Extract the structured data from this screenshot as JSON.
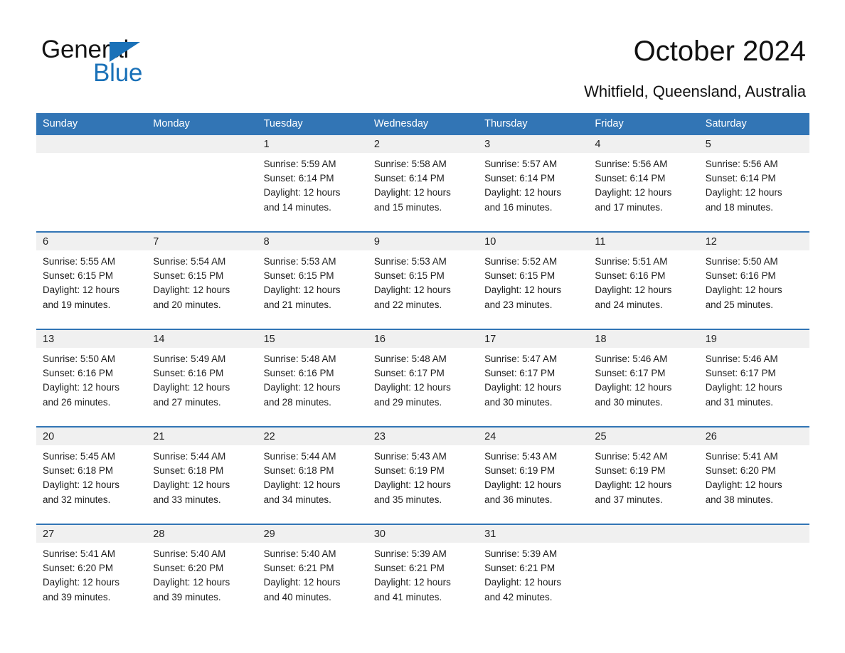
{
  "brand": {
    "name_top": "General",
    "name_bottom": "Blue",
    "accent_color": "#1a71b8",
    "triangle_icon": "triangle-icon"
  },
  "header": {
    "title": "October 2024",
    "location": "Whitfield, Queensland, Australia"
  },
  "theme": {
    "header_blue": "#3275b5",
    "date_band_gray": "#f0f0f0",
    "text_color": "#1d1d1d"
  },
  "calendar": {
    "weekday_headers": [
      "Sunday",
      "Monday",
      "Tuesday",
      "Wednesday",
      "Thursday",
      "Friday",
      "Saturday"
    ],
    "labels": {
      "sunrise": "Sunrise:",
      "sunset": "Sunset:",
      "daylight": "Daylight:"
    },
    "weeks": [
      [
        {
          "day": "",
          "sunrise": "",
          "sunset": "",
          "daylight_line1": "",
          "daylight_line2": "",
          "empty": true
        },
        {
          "day": "",
          "sunrise": "",
          "sunset": "",
          "daylight_line1": "",
          "daylight_line2": "",
          "empty": true
        },
        {
          "day": "1",
          "sunrise": "Sunrise: 5:59 AM",
          "sunset": "Sunset: 6:14 PM",
          "daylight_line1": "Daylight: 12 hours",
          "daylight_line2": "and 14 minutes."
        },
        {
          "day": "2",
          "sunrise": "Sunrise: 5:58 AM",
          "sunset": "Sunset: 6:14 PM",
          "daylight_line1": "Daylight: 12 hours",
          "daylight_line2": "and 15 minutes."
        },
        {
          "day": "3",
          "sunrise": "Sunrise: 5:57 AM",
          "sunset": "Sunset: 6:14 PM",
          "daylight_line1": "Daylight: 12 hours",
          "daylight_line2": "and 16 minutes."
        },
        {
          "day": "4",
          "sunrise": "Sunrise: 5:56 AM",
          "sunset": "Sunset: 6:14 PM",
          "daylight_line1": "Daylight: 12 hours",
          "daylight_line2": "and 17 minutes."
        },
        {
          "day": "5",
          "sunrise": "Sunrise: 5:56 AM",
          "sunset": "Sunset: 6:14 PM",
          "daylight_line1": "Daylight: 12 hours",
          "daylight_line2": "and 18 minutes."
        }
      ],
      [
        {
          "day": "6",
          "sunrise": "Sunrise: 5:55 AM",
          "sunset": "Sunset: 6:15 PM",
          "daylight_line1": "Daylight: 12 hours",
          "daylight_line2": "and 19 minutes."
        },
        {
          "day": "7",
          "sunrise": "Sunrise: 5:54 AM",
          "sunset": "Sunset: 6:15 PM",
          "daylight_line1": "Daylight: 12 hours",
          "daylight_line2": "and 20 minutes."
        },
        {
          "day": "8",
          "sunrise": "Sunrise: 5:53 AM",
          "sunset": "Sunset: 6:15 PM",
          "daylight_line1": "Daylight: 12 hours",
          "daylight_line2": "and 21 minutes."
        },
        {
          "day": "9",
          "sunrise": "Sunrise: 5:53 AM",
          "sunset": "Sunset: 6:15 PM",
          "daylight_line1": "Daylight: 12 hours",
          "daylight_line2": "and 22 minutes."
        },
        {
          "day": "10",
          "sunrise": "Sunrise: 5:52 AM",
          "sunset": "Sunset: 6:15 PM",
          "daylight_line1": "Daylight: 12 hours",
          "daylight_line2": "and 23 minutes."
        },
        {
          "day": "11",
          "sunrise": "Sunrise: 5:51 AM",
          "sunset": "Sunset: 6:16 PM",
          "daylight_line1": "Daylight: 12 hours",
          "daylight_line2": "and 24 minutes."
        },
        {
          "day": "12",
          "sunrise": "Sunrise: 5:50 AM",
          "sunset": "Sunset: 6:16 PM",
          "daylight_line1": "Daylight: 12 hours",
          "daylight_line2": "and 25 minutes."
        }
      ],
      [
        {
          "day": "13",
          "sunrise": "Sunrise: 5:50 AM",
          "sunset": "Sunset: 6:16 PM",
          "daylight_line1": "Daylight: 12 hours",
          "daylight_line2": "and 26 minutes."
        },
        {
          "day": "14",
          "sunrise": "Sunrise: 5:49 AM",
          "sunset": "Sunset: 6:16 PM",
          "daylight_line1": "Daylight: 12 hours",
          "daylight_line2": "and 27 minutes."
        },
        {
          "day": "15",
          "sunrise": "Sunrise: 5:48 AM",
          "sunset": "Sunset: 6:16 PM",
          "daylight_line1": "Daylight: 12 hours",
          "daylight_line2": "and 28 minutes."
        },
        {
          "day": "16",
          "sunrise": "Sunrise: 5:48 AM",
          "sunset": "Sunset: 6:17 PM",
          "daylight_line1": "Daylight: 12 hours",
          "daylight_line2": "and 29 minutes."
        },
        {
          "day": "17",
          "sunrise": "Sunrise: 5:47 AM",
          "sunset": "Sunset: 6:17 PM",
          "daylight_line1": "Daylight: 12 hours",
          "daylight_line2": "and 30 minutes."
        },
        {
          "day": "18",
          "sunrise": "Sunrise: 5:46 AM",
          "sunset": "Sunset: 6:17 PM",
          "daylight_line1": "Daylight: 12 hours",
          "daylight_line2": "and 30 minutes."
        },
        {
          "day": "19",
          "sunrise": "Sunrise: 5:46 AM",
          "sunset": "Sunset: 6:17 PM",
          "daylight_line1": "Daylight: 12 hours",
          "daylight_line2": "and 31 minutes."
        }
      ],
      [
        {
          "day": "20",
          "sunrise": "Sunrise: 5:45 AM",
          "sunset": "Sunset: 6:18 PM",
          "daylight_line1": "Daylight: 12 hours",
          "daylight_line2": "and 32 minutes."
        },
        {
          "day": "21",
          "sunrise": "Sunrise: 5:44 AM",
          "sunset": "Sunset: 6:18 PM",
          "daylight_line1": "Daylight: 12 hours",
          "daylight_line2": "and 33 minutes."
        },
        {
          "day": "22",
          "sunrise": "Sunrise: 5:44 AM",
          "sunset": "Sunset: 6:18 PM",
          "daylight_line1": "Daylight: 12 hours",
          "daylight_line2": "and 34 minutes."
        },
        {
          "day": "23",
          "sunrise": "Sunrise: 5:43 AM",
          "sunset": "Sunset: 6:19 PM",
          "daylight_line1": "Daylight: 12 hours",
          "daylight_line2": "and 35 minutes."
        },
        {
          "day": "24",
          "sunrise": "Sunrise: 5:43 AM",
          "sunset": "Sunset: 6:19 PM",
          "daylight_line1": "Daylight: 12 hours",
          "daylight_line2": "and 36 minutes."
        },
        {
          "day": "25",
          "sunrise": "Sunrise: 5:42 AM",
          "sunset": "Sunset: 6:19 PM",
          "daylight_line1": "Daylight: 12 hours",
          "daylight_line2": "and 37 minutes."
        },
        {
          "day": "26",
          "sunrise": "Sunrise: 5:41 AM",
          "sunset": "Sunset: 6:20 PM",
          "daylight_line1": "Daylight: 12 hours",
          "daylight_line2": "and 38 minutes."
        }
      ],
      [
        {
          "day": "27",
          "sunrise": "Sunrise: 5:41 AM",
          "sunset": "Sunset: 6:20 PM",
          "daylight_line1": "Daylight: 12 hours",
          "daylight_line2": "and 39 minutes."
        },
        {
          "day": "28",
          "sunrise": "Sunrise: 5:40 AM",
          "sunset": "Sunset: 6:20 PM",
          "daylight_line1": "Daylight: 12 hours",
          "daylight_line2": "and 39 minutes."
        },
        {
          "day": "29",
          "sunrise": "Sunrise: 5:40 AM",
          "sunset": "Sunset: 6:21 PM",
          "daylight_line1": "Daylight: 12 hours",
          "daylight_line2": "and 40 minutes."
        },
        {
          "day": "30",
          "sunrise": "Sunrise: 5:39 AM",
          "sunset": "Sunset: 6:21 PM",
          "daylight_line1": "Daylight: 12 hours",
          "daylight_line2": "and 41 minutes."
        },
        {
          "day": "31",
          "sunrise": "Sunrise: 5:39 AM",
          "sunset": "Sunset: 6:21 PM",
          "daylight_line1": "Daylight: 12 hours",
          "daylight_line2": "and 42 minutes."
        },
        {
          "day": "",
          "sunrise": "",
          "sunset": "",
          "daylight_line1": "",
          "daylight_line2": "",
          "empty": true
        },
        {
          "day": "",
          "sunrise": "",
          "sunset": "",
          "daylight_line1": "",
          "daylight_line2": "",
          "empty": true
        }
      ]
    ]
  }
}
